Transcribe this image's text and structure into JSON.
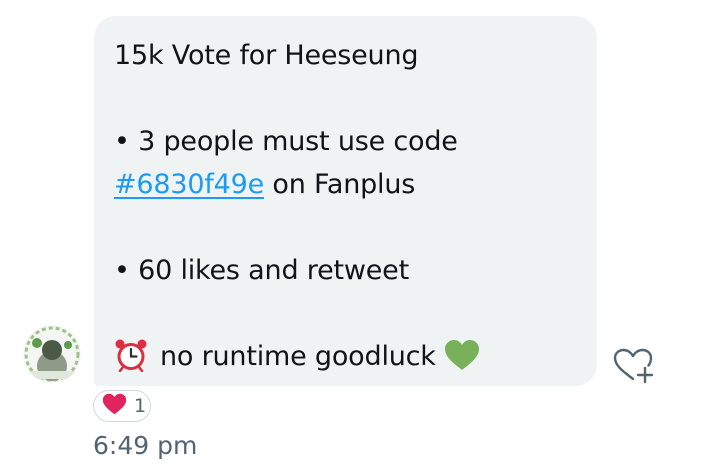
{
  "message": {
    "title": "15k Vote for Heeseung",
    "bullet1_prefix": "• 3 people must use code",
    "hashtag": "#6830f49e",
    "bullet1_suffix": " on Fanplus",
    "bullet2": "• 60 likes and retweet",
    "last_line_text": "no runtime goodluck",
    "last_line_emoji_start": "alarm-clock-emoji",
    "last_line_emoji_end": "green-heart-emoji"
  },
  "reaction": {
    "emoji": "red-heart-emoji",
    "count": "1"
  },
  "timestamp": "6:49 pm",
  "icons": {
    "add_reaction": "heart-plus-icon"
  },
  "colors": {
    "bubble": "#eff3f4",
    "link": "#1d9bf0",
    "heart_red": "#e0245e",
    "heart_green": "#78b159",
    "alarm_red": "#dd2e44",
    "muted": "#536471"
  }
}
